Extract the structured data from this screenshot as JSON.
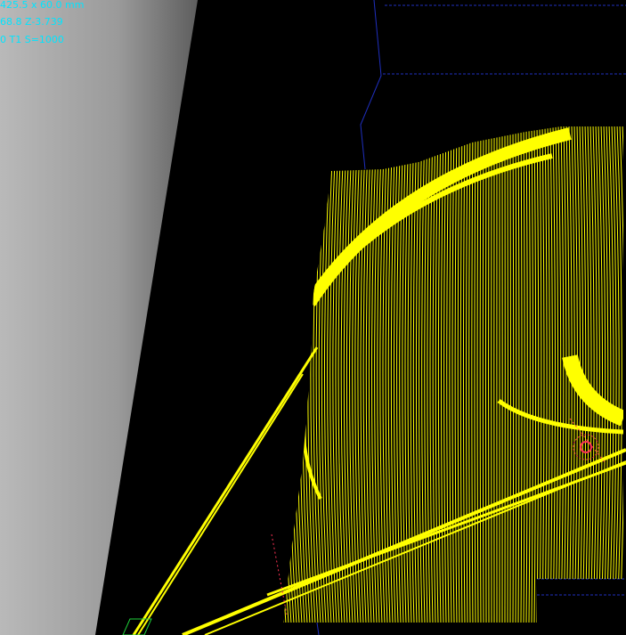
{
  "viewer": {
    "dimensions_text": "425.5 x 60.0 mm",
    "position_text": "68.8 Z-3.739",
    "tool_text": "0 T1 S=1000",
    "colors": {
      "background": "#000000",
      "toolpath": "#ffff00",
      "overlay_text": "#00e5ff",
      "boundary": "#1f2fbf",
      "tool_marker": "#ff3355",
      "origin_marker": "#1fd13a"
    }
  }
}
